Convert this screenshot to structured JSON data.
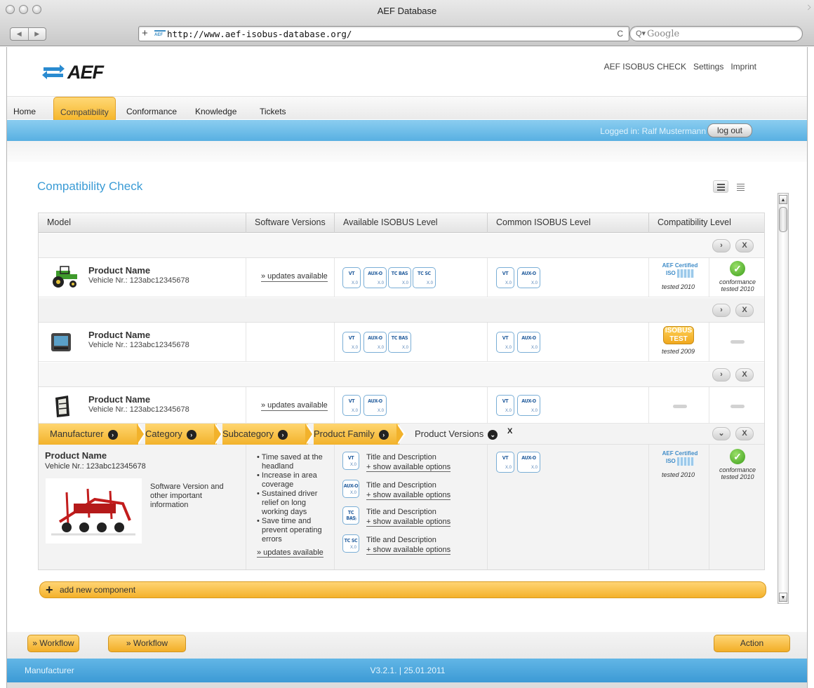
{
  "window": {
    "title": "AEF Database"
  },
  "browser": {
    "url": "http://www.aef-isobus-database.org/",
    "search_placeholder": "Google",
    "back": "◀",
    "forward": "▶",
    "add": "+",
    "reload": "C"
  },
  "brand": {
    "logo_text": "AEF"
  },
  "top_links": [
    "AEF ISOBUS CHECK",
    "Settings",
    "Imprint"
  ],
  "nav": {
    "tabs": [
      "Home",
      "Compatibility",
      "Conformance",
      "Knowledge",
      "Tickets"
    ],
    "active": "Compatibility"
  },
  "session": {
    "logged_in": "Logged in: Ralf Mustermann",
    "logout": "log out"
  },
  "page": {
    "title": "Compatibility Check"
  },
  "table": {
    "headers": [
      "Model",
      "Software Versions",
      "Available ISOBUS Level",
      "Common ISOBUS Level",
      "Compatibility Level"
    ],
    "controls": {
      "expand": "›",
      "close": "X",
      "collapse": "⌄"
    },
    "rows": [
      {
        "name": "Product Name",
        "vehicle": "Vehicle Nr.: 123abc12345678",
        "updates": "» updates available",
        "available": [
          {
            "t": "VT",
            "v": "X.0"
          },
          {
            "t": "AUX-O",
            "v": "X.0"
          },
          {
            "t": "TC BAS",
            "v": "X.0"
          },
          {
            "t": "TC SC",
            "v": "X.0"
          }
        ],
        "common": [
          {
            "t": "VT",
            "v": "X.0"
          },
          {
            "t": "AUX-O",
            "v": "X.0"
          }
        ],
        "cert": "AEF Certified",
        "cert_iso": "ISO",
        "cert_year": "tested 2010",
        "conf1": "conformance",
        "conf2": "tested 2010"
      },
      {
        "name": "Product Name",
        "vehicle": "Vehicle Nr.: 123abc12345678",
        "available": [
          {
            "t": "VT",
            "v": "X.0"
          },
          {
            "t": "AUX-O",
            "v": "X.0"
          },
          {
            "t": "TC BAS",
            "v": "X.0"
          }
        ],
        "common": [
          {
            "t": "VT",
            "v": "X.0"
          },
          {
            "t": "AUX-O",
            "v": "X.0"
          }
        ],
        "test_top": "ISOBUS",
        "test_bottom": "TEST",
        "test_year": "tested 2009"
      },
      {
        "name": "Product Name",
        "vehicle": "Vehicle Nr.: 123abc12345678",
        "updates": "» updates available",
        "available": [
          {
            "t": "VT",
            "v": "X.0"
          },
          {
            "t": "AUX-O",
            "v": "X.0"
          }
        ],
        "common": [
          {
            "t": "VT",
            "v": "X.0"
          },
          {
            "t": "AUX-O",
            "v": "X.0"
          }
        ]
      }
    ]
  },
  "breadcrumb": [
    "Manufacturer",
    "Category",
    "Subcategory",
    "Product Family",
    "Product Versions"
  ],
  "breadcrumb_x": "X",
  "detail": {
    "name": "Product Name",
    "vehicle": "Vehicle Nr.: 123abc12345678",
    "info": "Software Version and other important information",
    "bullets": [
      "Time saved at the headland",
      "Increase in area coverage",
      "Sustained driver relief on long working days",
      "Save time and prevent operating errors"
    ],
    "updates": "» updates available",
    "options": [
      {
        "t": "VT",
        "v": "X.0",
        "title": "Title and Description",
        "link": "+ show available options"
      },
      {
        "t": "AUX-O",
        "v": "X.0",
        "title": "Title and Description",
        "link": "+ show available options"
      },
      {
        "t": "TC BAS",
        "v": "X.0",
        "title": "Title and Description",
        "link": "+ show available options"
      },
      {
        "t": "TC SC",
        "v": "X.0",
        "title": "Title and Description",
        "link": "+ show available options"
      }
    ],
    "common": [
      {
        "t": "VT",
        "v": "X.0"
      },
      {
        "t": "AUX-O",
        "v": "X.0"
      }
    ],
    "cert": "AEF Certified",
    "cert_iso": "ISO",
    "cert_year": "tested 2010",
    "conf1": "conformance",
    "conf2": "tested 2010"
  },
  "add_component": "add new component",
  "bottom": {
    "workflow1": "» Workflow",
    "workflow2": "» Workflow",
    "action": "Action"
  },
  "footer": {
    "left": "Manufacturer",
    "version": "V3.2.1. | 25.01.2011"
  },
  "colors": {
    "accent_blue": "#3a9bd5",
    "orange": "#f4b12a",
    "check_green": "#3b9d1a"
  }
}
